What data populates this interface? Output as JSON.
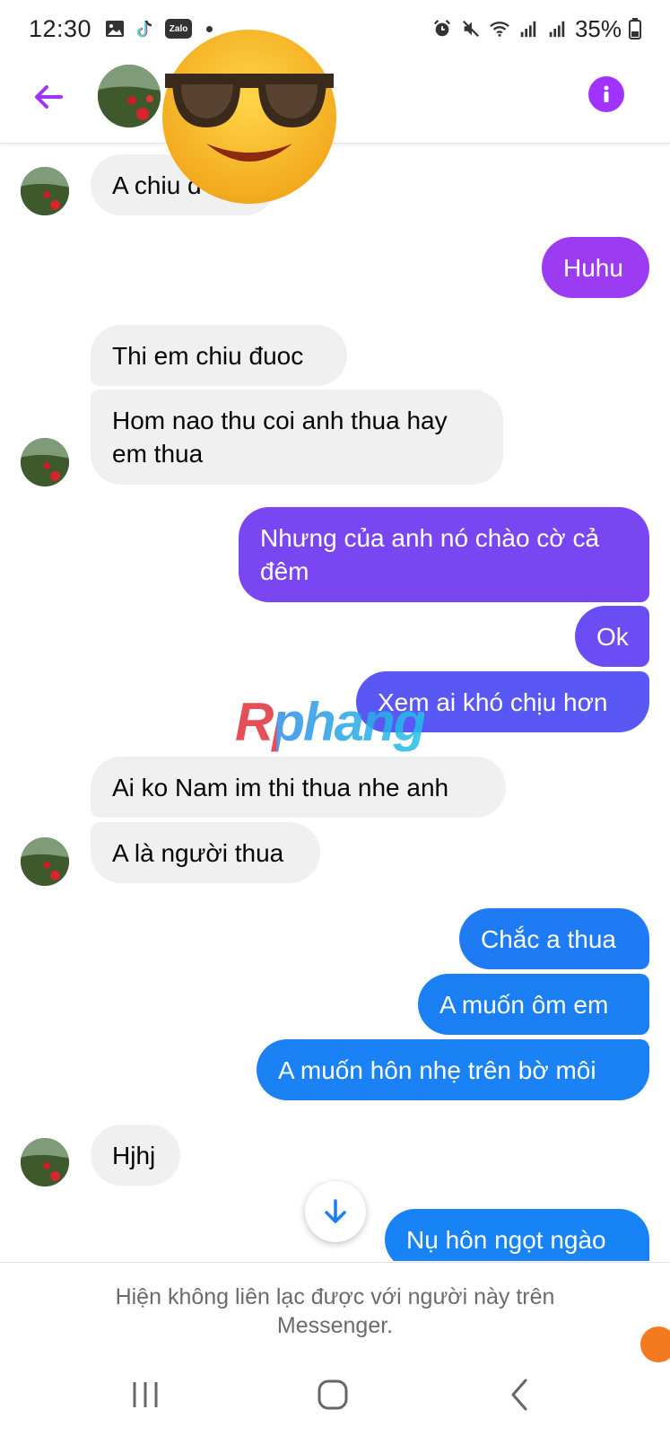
{
  "status_bar": {
    "time": "12:30",
    "notification_icons": [
      "gallery-icon",
      "tiktok-icon",
      "zalo-icon"
    ],
    "zalo_label": "Zalo",
    "system_icons": [
      "alarm-icon",
      "mute-icon",
      "wifi-icon",
      "signal-icon",
      "signal-icon"
    ],
    "battery_percent": "35%"
  },
  "header": {
    "back_icon": "back-arrow-icon",
    "info_icon": "info-icon",
    "accent_color": "#a033ff"
  },
  "messages": [
    {
      "side": "in",
      "text": "A chiu đ",
      "avatar": true
    },
    {
      "side": "out",
      "text": "Huhu",
      "color": "#9b3bf2"
    },
    {
      "side": "in",
      "text": "Thi em chiu đuoc",
      "avatar": false
    },
    {
      "side": "in",
      "lines": [
        "Hom nao thu coi anh thua hay",
        "em thua"
      ],
      "avatar": true
    },
    {
      "side": "out",
      "lines": [
        "Nhưng của anh nó chào cờ cả",
        "đêm"
      ],
      "color": "#7a46f2"
    },
    {
      "side": "out",
      "text": "Ok",
      "color": "#6a4ef4"
    },
    {
      "side": "out",
      "text": "Xem ai khó chịu hơn",
      "color": "#5a58f5"
    },
    {
      "side": "in",
      "text": "Ai ko Nam im thi thua nhe anh",
      "avatar": false
    },
    {
      "side": "in",
      "text": "A là người thua",
      "avatar": true
    },
    {
      "side": "out",
      "text": "Chắc a thua",
      "color": "#1f7bf3"
    },
    {
      "side": "out",
      "text": "A muốn ôm em",
      "color": "#1b7ff4"
    },
    {
      "side": "out",
      "text": "A muốn hôn nhẹ trên bờ môi",
      "color": "#1a82f5"
    },
    {
      "side": "in",
      "text": "Hjhj",
      "avatar": true
    },
    {
      "side": "out",
      "text": "Nụ hôn ngọt ngào",
      "color": "#1883f5"
    }
  ],
  "watermark": "Rphang",
  "scroll_down_icon": "arrow-down-icon",
  "footer": {
    "line1": "Hiện không liên lạc được với người này trên",
    "line2": "Messenger."
  },
  "navbar": {
    "icons": [
      "recent-apps-icon",
      "home-icon",
      "back-icon"
    ]
  }
}
